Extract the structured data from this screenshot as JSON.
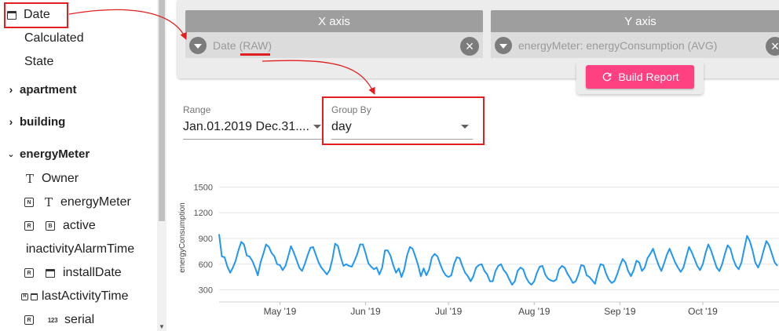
{
  "sidebar": {
    "items": [
      {
        "label": "Date",
        "icon": "calendar-icon"
      },
      {
        "label": "Calculated"
      },
      {
        "label": "State"
      },
      {
        "label": "apartment",
        "icon": "chevron-right-icon"
      },
      {
        "label": "building",
        "icon": "chevron-right-icon"
      },
      {
        "label": "energyMeter",
        "icon": "chevron-down-icon"
      },
      {
        "label": "Owner",
        "icon": "text-type-icon",
        "type_glyph": "T"
      },
      {
        "label": "energyMeter",
        "badge": "N",
        "icon": "text-type-icon",
        "type_glyph": "T"
      },
      {
        "label": "active",
        "badge": "R",
        "icon": "boolean-type-icon",
        "type_glyph": "B"
      },
      {
        "label": "inactivityAlarmTime"
      },
      {
        "label": "installDate",
        "badge": "R",
        "icon": "calendar-icon"
      },
      {
        "label": "lastActivityTime",
        "badge": "R",
        "icon": "calendar-icon"
      },
      {
        "label": "serial",
        "badge": "R",
        "icon": "number-type-icon",
        "type_glyph": "123"
      }
    ]
  },
  "axes": {
    "x": {
      "header": "X axis",
      "field_name": "Date",
      "field_agg": "(RAW)"
    },
    "y": {
      "header": "Y axis",
      "field": "energyMeter: energyConsumption (AVG)"
    },
    "clear_glyph": "×"
  },
  "build_report": {
    "label": "Build Report"
  },
  "range": {
    "label": "Range",
    "value": "Jan.01.2019 Dec.31...."
  },
  "group_by": {
    "label": "Group By",
    "value": "day"
  },
  "colors": {
    "accent": "#ff4081",
    "series": "#2196f3",
    "highlight": "#e02020"
  },
  "chart_data": {
    "type": "line",
    "ylabel": "energyConsumption",
    "ylim": [
      250,
      1550
    ],
    "yticks": [
      300,
      600,
      900,
      1200,
      1500
    ],
    "xticks": [
      "May '19",
      "Jun '19",
      "Jul '19",
      "Aug '19",
      "Sep '19",
      "Oct '19"
    ],
    "xtick_dates": [
      "2019-05-01",
      "2019-06-01",
      "2019-07-01",
      "2019-08-01",
      "2019-09-01",
      "2019-10-01"
    ],
    "visible_range": [
      "2019-04-09",
      "2019-10-28"
    ],
    "series": [
      {
        "start_date": "2019-04-09",
        "values": [
          950,
          690,
          680,
          570,
          500,
          560,
          640,
          760,
          860,
          830,
          700,
          690,
          640,
          560,
          470,
          620,
          720,
          830,
          800,
          730,
          690,
          600,
          590,
          530,
          580,
          690,
          810,
          740,
          650,
          560,
          520,
          600,
          700,
          790,
          800,
          710,
          620,
          560,
          520,
          480,
          530,
          660,
          840,
          810,
          680,
          580,
          600,
          580,
          570,
          640,
          720,
          830,
          830,
          730,
          610,
          570,
          540,
          560,
          480,
          560,
          760,
          760,
          700,
          590,
          500,
          550,
          450,
          540,
          700,
          800,
          780,
          690,
          590,
          460,
          550,
          470,
          540,
          680,
          720,
          690,
          600,
          520,
          470,
          450,
          470,
          600,
          680,
          670,
          580,
          500,
          460,
          400,
          460,
          560,
          590,
          600,
          520,
          480,
          400,
          400,
          520,
          580,
          600,
          530,
          490,
          420,
          360,
          400,
          520,
          560,
          540,
          450,
          390,
          360,
          400,
          500,
          570,
          580,
          480,
          430,
          410,
          400,
          420,
          540,
          580,
          560,
          490,
          440,
          380,
          400,
          480,
          590,
          580,
          470,
          450,
          410,
          370,
          500,
          600,
          590,
          490,
          420,
          380,
          400,
          480,
          580,
          660,
          620,
          520,
          460,
          530,
          640,
          620,
          520,
          560,
          670,
          720,
          780,
          680,
          590,
          520,
          610,
          710,
          780,
          700,
          620,
          560,
          510,
          560,
          680,
          800,
          740,
          660,
          580,
          530,
          600,
          730,
          830,
          760,
          660,
          560,
          520,
          600,
          720,
          820,
          780,
          660,
          580,
          540,
          620,
          780,
          930,
          870,
          760,
          620,
          560,
          640,
          760,
          870,
          820,
          720,
          620,
          580,
          660,
          790,
          920,
          880,
          760,
          640,
          600,
          700,
          820,
          900,
          830,
          720,
          620,
          570,
          650,
          780,
          940,
          950,
          830,
          700,
          610,
          680,
          800,
          930,
          900,
          780,
          660,
          590,
          640,
          770,
          900,
          880,
          760,
          640,
          580
        ]
      }
    ]
  }
}
